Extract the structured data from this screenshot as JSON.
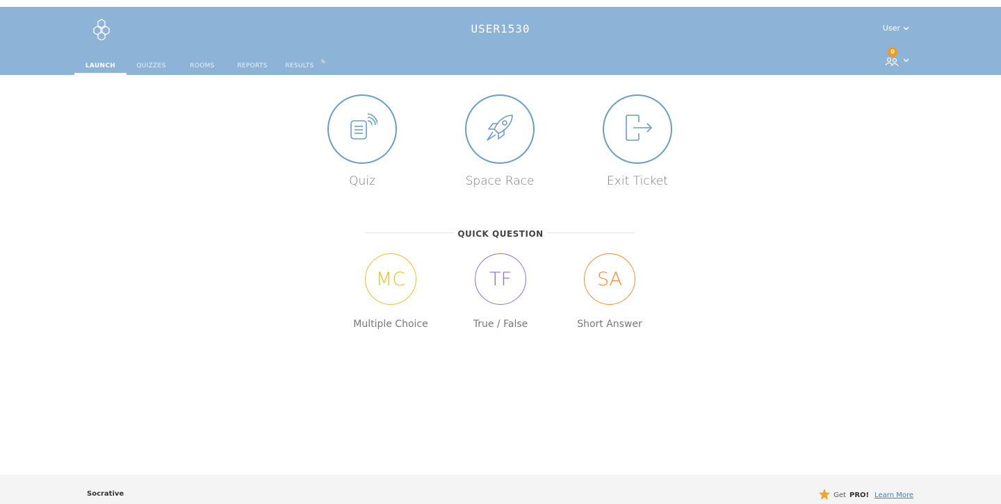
{
  "header": {
    "room_name": "USER1530",
    "user_menu_label": "User",
    "student_count": "0",
    "bg_color": "#8db3d6"
  },
  "nav": {
    "items": [
      {
        "label": "LAUNCH",
        "active": true
      },
      {
        "label": "QUIZZES",
        "active": false
      },
      {
        "label": "ROOMS",
        "active": false
      },
      {
        "label": "REPORTS",
        "active": false
      },
      {
        "label": "RESULTS",
        "active": false
      }
    ]
  },
  "launch": {
    "items": [
      {
        "label": "Quiz",
        "icon": "quiz-icon"
      },
      {
        "label": "Space Race",
        "icon": "rocket-icon"
      },
      {
        "label": "Exit Ticket",
        "icon": "exit-door-icon"
      }
    ],
    "circle_color": "#6b9cc3"
  },
  "quick_question": {
    "title": "QUICK QUESTION",
    "items": [
      {
        "abbr": "MC",
        "label": "Multiple Choice",
        "color": "#e6c029"
      },
      {
        "abbr": "TF",
        "label": "True / False",
        "color": "#8c6fd1"
      },
      {
        "abbr": "SA",
        "label": "Short Answer",
        "color": "#f28b3a"
      }
    ]
  },
  "footer": {
    "brand": "Socrative",
    "get_text": "Get",
    "pro_text": "PRO!",
    "learn_more": "Learn More"
  }
}
